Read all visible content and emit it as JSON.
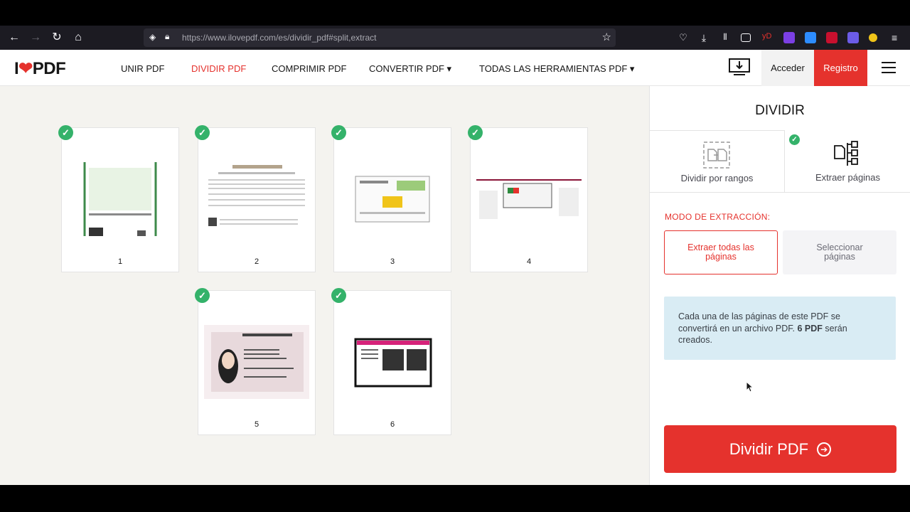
{
  "browser": {
    "url_host": "https://www.ilovepdf.com",
    "url_path": "/es/dividir_pdf#split,extract"
  },
  "header": {
    "logo_left": "I",
    "logo_right": "PDF",
    "nav": [
      "UNIR PDF",
      "DIVIDIR PDF",
      "COMPRIMIR PDF",
      "CONVERTIR PDF ▾",
      "TODAS LAS HERRAMIENTAS PDF ▾"
    ],
    "login": "Acceder",
    "register": "Registro"
  },
  "pages": [
    "1",
    "2",
    "3",
    "4",
    "5",
    "6"
  ],
  "sidebar": {
    "title": "DIVIDIR",
    "mode_ranges": "Dividir por rangos",
    "mode_extract": "Extraer páginas",
    "extraction_label": "MODO DE EXTRACCIÓN:",
    "option_all": "Extraer todas las páginas",
    "option_select": "Seleccionar páginas",
    "info_part1": "Cada una de las páginas de este PDF se convertirá en un archivo PDF.",
    "info_bold": "6 PDF",
    "info_part2": "serán creados.",
    "split_button": "Dividir PDF"
  },
  "colors": {
    "brand_red": "#e5322d",
    "check_green": "#34b26a",
    "info_bg": "#d9ecf4"
  }
}
